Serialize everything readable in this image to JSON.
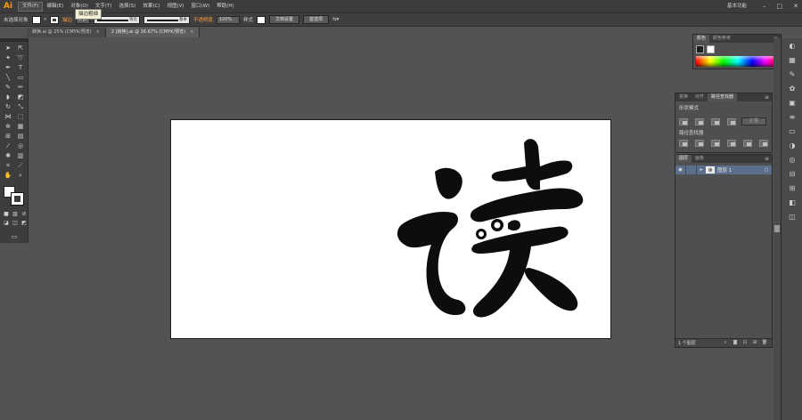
{
  "app": {
    "logo": "Ai",
    "workspace": "基本功能"
  },
  "menu": [
    "文件(F)",
    "编辑(E)",
    "对象(O)",
    "文字(T)",
    "选择(S)",
    "效果(C)",
    "视图(V)",
    "窗口(W)",
    "帮助(H)"
  ],
  "tooltip": "描边粗细",
  "window_controls": {
    "minimize": "–",
    "restore": "□",
    "close": "✕"
  },
  "control_bar": {
    "selection": "未选择对象",
    "stroke_label": "描边",
    "stroke_weight": "1 pt",
    "profile_label": "等比",
    "brush_label": "基本",
    "opacity_label": "不透明度",
    "opacity_value": "100%",
    "style_label": "样式",
    "doc_setup": "文档设置",
    "preferences": "首选项"
  },
  "tabs": [
    {
      "label": "转换.ai @ 25% (CMYK/预览)",
      "close": "×"
    },
    {
      "label": "2 [转换].ai @ 16.67% (CMYK/预览)",
      "close": "×"
    }
  ],
  "artwork": {
    "character": "读",
    "color": "#0d0d0d"
  },
  "color_panel": {
    "tabs": [
      "颜色",
      "颜色参考"
    ]
  },
  "pathfinder_panel": {
    "tabs": [
      "变换",
      "对齐",
      "路径查找器"
    ],
    "shape_modes_label": "形状模式",
    "pathfinders_label": "路径查找器",
    "expand_label": "扩展"
  },
  "layers_panel": {
    "tabs": [
      "图层",
      "画板"
    ],
    "layer_name": "图层 1",
    "footer_count": "1 个图层"
  },
  "colors": {
    "accent_layer": "#5b6e8c",
    "logo": "#ff9a00"
  }
}
